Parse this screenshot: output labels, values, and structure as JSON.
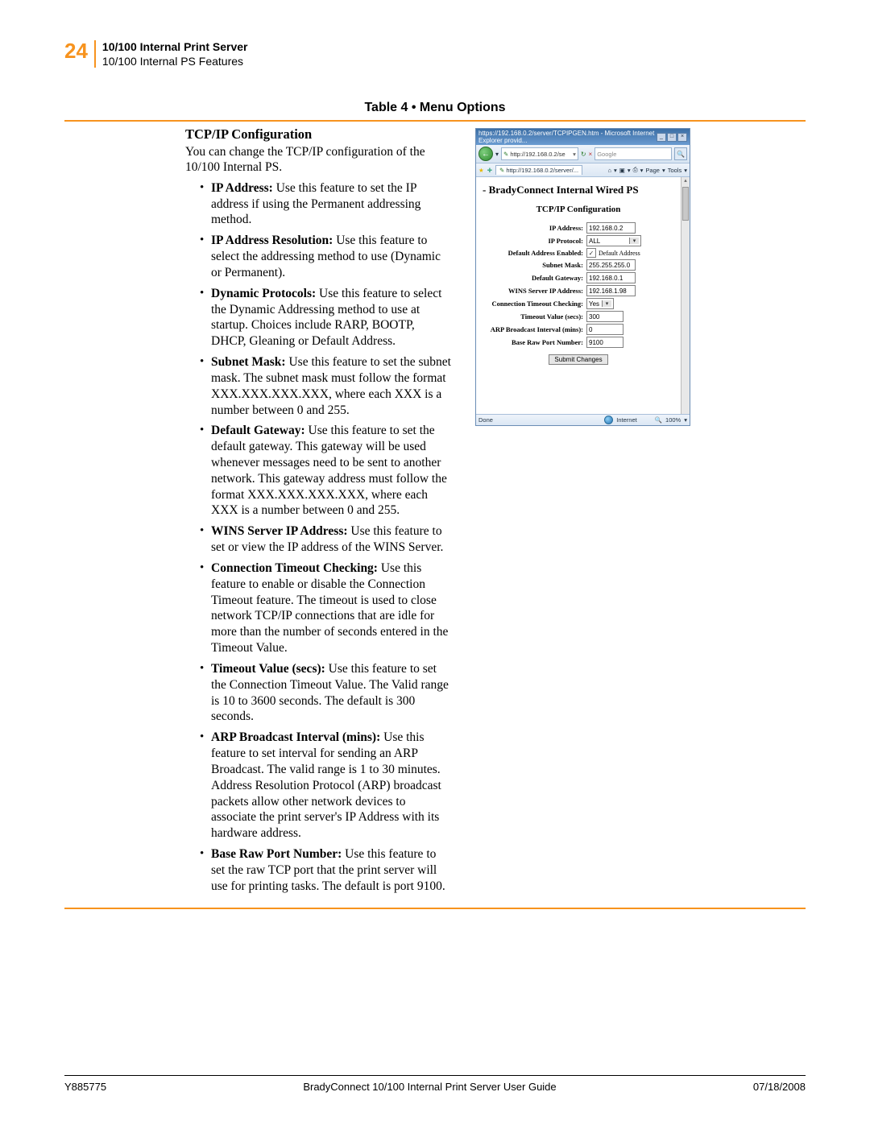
{
  "header": {
    "page_number": "24",
    "title_bold": "10/100 Internal Print Server",
    "subtitle": "10/100 Internal PS Features"
  },
  "table_caption": "Table 4 • Menu Options",
  "section": {
    "title": "TCP/IP Configuration",
    "intro": "You can change the TCP/IP configuration of the 10/100 Internal PS.",
    "items": [
      {
        "label": "IP Address:",
        "text": " Use this feature to set the IP address if using the Permanent addressing method."
      },
      {
        "label": "IP Address Resolution:",
        "text": " Use this feature to select the addressing method to use (Dynamic or Permanent)."
      },
      {
        "label": "Dynamic Protocols:",
        "text": " Use this feature to select the Dynamic Addressing method to use at startup. Choices include RARP, BOOTP, DHCP, Gleaning or Default Address."
      },
      {
        "label": "Subnet Mask:",
        "text": " Use this feature to set the subnet mask. The subnet mask must follow the format XXX.XXX.XXX.XXX, where each XXX is a number between 0 and 255."
      },
      {
        "label": "Default Gateway:",
        "text": " Use this feature to set the default gateway. This gateway will be used whenever messages need to be sent to another network. This gateway address must follow the format XXX.XXX.XXX.XXX, where each XXX is a number between 0 and 255."
      },
      {
        "label": "WINS Server IP Address:",
        "text": " Use this feature to set or view the IP address of the WINS Server."
      },
      {
        "label": "Connection Timeout Checking:",
        "text": " Use this feature to enable or disable the Connection Timeout feature. The timeout is used to close network TCP/IP connections that are idle for more than the number of seconds entered in the Timeout Value."
      },
      {
        "label": "Timeout Value (secs):",
        "text": " Use this feature to set the Connection Timeout Value. The Valid range is 10 to 3600 seconds. The default is 300 seconds."
      },
      {
        "label": "ARP Broadcast Interval (mins):",
        "text": " Use this feature to set interval for sending an ARP Broadcast. The valid range is 1 to 30 minutes. Address Resolution Protocol (ARP) broadcast packets allow other network devices to associate the print server's IP Address with its hardware address."
      },
      {
        "label": "Base Raw Port Number:",
        "text": " Use this feature to set the raw TCP port that the print server will use for printing tasks. The default is port 9100."
      }
    ]
  },
  "browser": {
    "titlebar": "https://192.168.0.2/server/TCPIPGEN.htm - Microsoft Internet Explorer provid...",
    "address": "http://192.168.0.2/se",
    "search_placeholder": "Google",
    "tab_label": "http://192.168.0.2/server/...",
    "toolbar_items": {
      "page": "Page",
      "tools": "Tools"
    },
    "heading": "- BradyConnect Internal Wired PS",
    "subheading": "TCP/IP Configuration",
    "fields": {
      "ip_address": {
        "label": "IP Address:",
        "value": "192.168.0.2"
      },
      "ip_protocol": {
        "label": "IP Protocol:",
        "value": "ALL"
      },
      "default_address_enabled": {
        "label": "Default Address Enabled:",
        "cb_text": "Default Address",
        "checked": true
      },
      "subnet_mask": {
        "label": "Subnet Mask:",
        "value": "255.255.255.0"
      },
      "default_gateway": {
        "label": "Default Gateway:",
        "value": "192.168.0.1"
      },
      "wins": {
        "label": "WINS Server IP Address:",
        "value": "192.168.1.98"
      },
      "conn_timeout": {
        "label": "Connection Timeout Checking:",
        "value": "Yes"
      },
      "timeout_val": {
        "label": "Timeout Value (secs):",
        "value": "300"
      },
      "arp": {
        "label": "ARP Broadcast Interval (mins):",
        "value": "0"
      },
      "base_port": {
        "label": "Base Raw Port Number:",
        "value": "9100"
      }
    },
    "submit": "Submit Changes",
    "status": {
      "done": "Done",
      "zone": "Internet",
      "zoom": "100%"
    }
  },
  "footer": {
    "left": "Y885775",
    "center": "BradyConnect 10/100 Internal Print Server User Guide",
    "right": "07/18/2008"
  }
}
